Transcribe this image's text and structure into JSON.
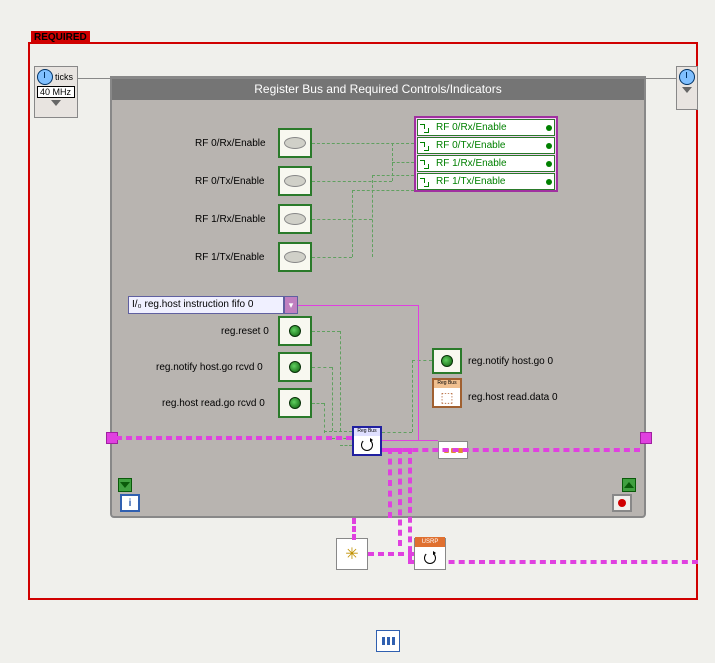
{
  "frame": {
    "required_label": "REQUIRED"
  },
  "clock": {
    "ticks": "ticks",
    "rate": "40 MHz"
  },
  "loop": {
    "title": "Register Bus and Required Controls/Indicators"
  },
  "controls": {
    "rf0rx": "RF 0/Rx/Enable",
    "rf0tx": "RF 0/Tx/Enable",
    "rf1rx": "RF 1/Rx/Enable",
    "rf1tx": "RF 1/Tx/Enable"
  },
  "indicators": {
    "rf0rx": "RF 0/Rx/Enable",
    "rf0tx": "RF 0/Tx/Enable",
    "rf1rx": "RF 1/Rx/Enable",
    "rf1tx": "RF 1/Tx/Enable"
  },
  "registers": {
    "fifo": "reg.host instruction fifo 0",
    "reset": "reg.reset 0",
    "notify_go_rcvd": "reg.notify host.go rcvd 0",
    "read_go_rcvd": "reg.host read.go rcvd 0",
    "notify_go": "reg.notify host.go 0",
    "read_data": "reg.host read.data 0"
  },
  "nodes": {
    "regbus": "Reg Bus",
    "regbus2": "Reg Bus",
    "usrp": "USRP",
    "i": "i"
  }
}
